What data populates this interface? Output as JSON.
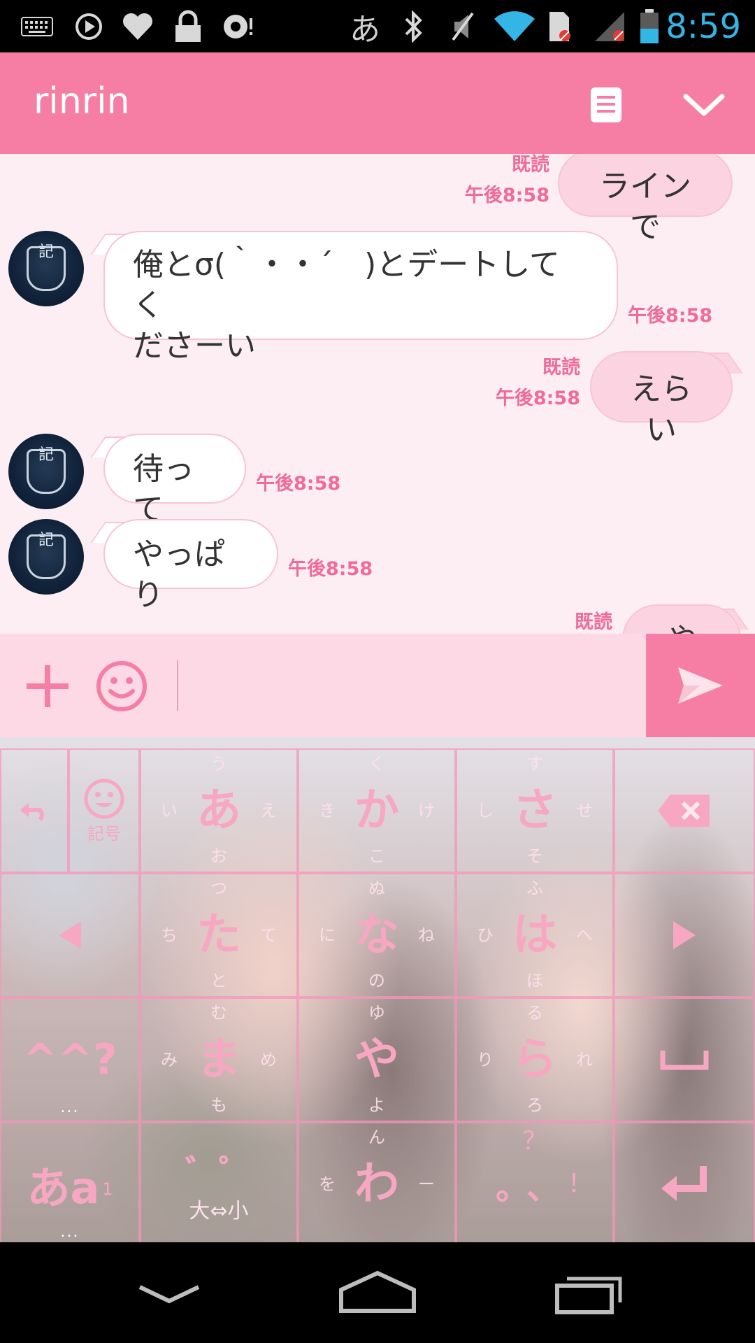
{
  "status_bar": {
    "time": "8:59",
    "kana_indicator": "あ",
    "icons": [
      "keyboard-icon",
      "play-icon",
      "heart-icon",
      "lock-icon",
      "sync-icon",
      "bluetooth-icon",
      "mute-icon",
      "wifi-icon",
      "sd-card-icon",
      "signal-icon",
      "battery-icon"
    ]
  },
  "header": {
    "title": "rinrin",
    "note_icon": "note-icon",
    "collapse_icon": "chevron-down-icon"
  },
  "messages": [
    {
      "side": "out",
      "text": "ラインで",
      "read": "既読",
      "time": "午後8:58"
    },
    {
      "side": "in",
      "line1": "俺とσ(｀・・´　)とデートしてく",
      "line2": "ださーい",
      "time": "午後8:58"
    },
    {
      "side": "out",
      "text": "えらい",
      "read": "既読",
      "time": "午後8:58"
    },
    {
      "side": "in",
      "text": "待って",
      "time": "午後8:58"
    },
    {
      "side": "in",
      "text": "やっぱり",
      "time": "午後8:58"
    },
    {
      "side": "out",
      "text": "やだ",
      "read": "既読"
    }
  ],
  "input": {
    "value": "",
    "placeholder": ""
  },
  "keyboard": {
    "left_col": {
      "emoji_label": "記号"
    },
    "keys": [
      {
        "main": "あ",
        "u": "う",
        "l": "い",
        "r": "え",
        "d": "お"
      },
      {
        "main": "か",
        "u": "く",
        "l": "き",
        "r": "け",
        "d": "こ"
      },
      {
        "main": "さ",
        "u": "す",
        "l": "し",
        "r": "せ",
        "d": "そ"
      },
      {
        "main": "た",
        "u": "つ",
        "l": "ち",
        "r": "て",
        "d": "と"
      },
      {
        "main": "な",
        "u": "ぬ",
        "l": "に",
        "r": "ね",
        "d": "の"
      },
      {
        "main": "は",
        "u": "ふ",
        "l": "ひ",
        "r": "へ",
        "d": "ほ"
      },
      {
        "main": "ま",
        "u": "む",
        "l": "み",
        "r": "め",
        "d": "も"
      },
      {
        "main": "や",
        "u": "ゆ",
        "l": "",
        "r": "",
        "d": "よ"
      },
      {
        "main": "ら",
        "u": "る",
        "l": "り",
        "r": "れ",
        "d": "ろ"
      },
      {
        "main": "わ",
        "u": "ん",
        "l": "を",
        "r": "ー",
        "d": ""
      }
    ],
    "mode_label": "あa",
    "mode_sub": "1",
    "dakuten_label": "゛゜",
    "size_label": "大⇔小",
    "punct_main": "。、",
    "punct_up": "？",
    "punct_right": "！",
    "emoticon_label": "^^?",
    "dots": "..."
  },
  "nav_bar": {
    "icons": [
      "back-icon",
      "home-icon",
      "recents-icon"
    ]
  }
}
